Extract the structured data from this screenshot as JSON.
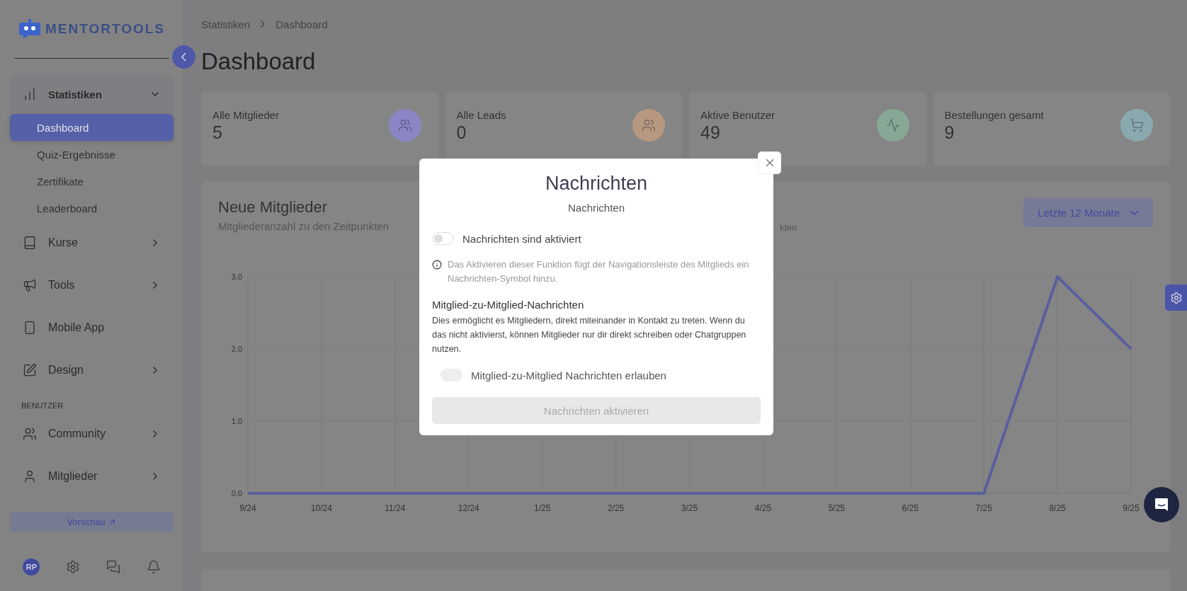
{
  "sidebar": {
    "logo": "MENTORTOOLS",
    "nav": [
      {
        "kind": "group",
        "label": "Statistiken",
        "expanded": true,
        "children": [
          {
            "label": "Dashboard",
            "selected": true
          },
          {
            "label": "Quiz-Ergebnisse",
            "selected": false
          },
          {
            "label": "Zertifikate",
            "selected": false
          },
          {
            "label": "Leaderboard",
            "selected": false
          }
        ]
      },
      {
        "kind": "item",
        "label": "Kurse"
      },
      {
        "kind": "item",
        "label": "Tools"
      },
      {
        "kind": "link",
        "label": "Mobile App"
      },
      {
        "kind": "item",
        "label": "Design"
      },
      {
        "kind": "section",
        "label": "BENUTZER"
      },
      {
        "kind": "item",
        "label": "Community"
      },
      {
        "kind": "item",
        "label": "Mitglieder"
      }
    ],
    "preview_button": "Vorschau",
    "avatar": "RP"
  },
  "breadcrumb": [
    "Statistiken",
    "Dashboard"
  ],
  "page_title": "Dashboard",
  "stats": [
    {
      "label": "Alle Mitglieder",
      "value": "5",
      "color": "#8a86c6"
    },
    {
      "label": "Alle Leads",
      "value": "0",
      "color": "#b7987f"
    },
    {
      "label": "Aktive Benutzer",
      "value": "49",
      "color": "#86a894"
    },
    {
      "label": "Bestellungen gesamt",
      "value": "9",
      "color": "#8aa9af"
    }
  ],
  "chart_card": {
    "title": "Neue Mitglieder",
    "subtitle": "Mitgliederanzahl zu den Zeitpunkten",
    "hidden_subtitle_fragment": "kten",
    "range": "Letzte 12 Monate",
    "chart_data": {
      "type": "line",
      "categories": [
        "9/24",
        "10/24",
        "11/24",
        "12/24",
        "1/25",
        "2/25",
        "3/25",
        "4/25",
        "5/25",
        "6/25",
        "7/25",
        "8/25",
        "9/25"
      ],
      "grid": true,
      "series": [
        {
          "color": "#5a5f9e",
          "values": [
            0,
            0,
            0,
            0,
            0,
            0,
            0,
            0,
            0,
            0,
            0,
            3,
            2
          ]
        }
      ],
      "ylim": [
        0,
        3
      ],
      "yticks": [
        {
          "value": 0,
          "label": "0.0"
        },
        {
          "value": 1,
          "label": "1.0"
        },
        {
          "value": 2,
          "label": "2.0"
        },
        {
          "value": 3,
          "label": "3.0"
        }
      ]
    }
  },
  "modal": {
    "title": "Nachrichten",
    "subtitle": "Nachrichten",
    "enable_toggle": {
      "label": "Nachrichten sind aktiviert",
      "on": false,
      "disabled": false
    },
    "info": "Das Aktivieren dieser Funktion fügt der Navigationsleiste des Mitglieds ein Nachrichten-Symbol hinzu.",
    "section_title": "Mitglied-zu-Mitglied-Nachrichten",
    "section_text": "Dies ermöglicht es Mitgliedern, direkt miteinander in Kontakt zu treten. Wenn du das nicht aktivierst, können Mitglieder nur dir direkt schreiben oder Chatgruppen nutzen.",
    "member_toggle": {
      "label": "Mitglied-zu-Mitglied Nachrichten erlauben",
      "on": false,
      "disabled": true
    },
    "submit": {
      "label": "Nachrichten aktivieren",
      "disabled": true
    }
  }
}
